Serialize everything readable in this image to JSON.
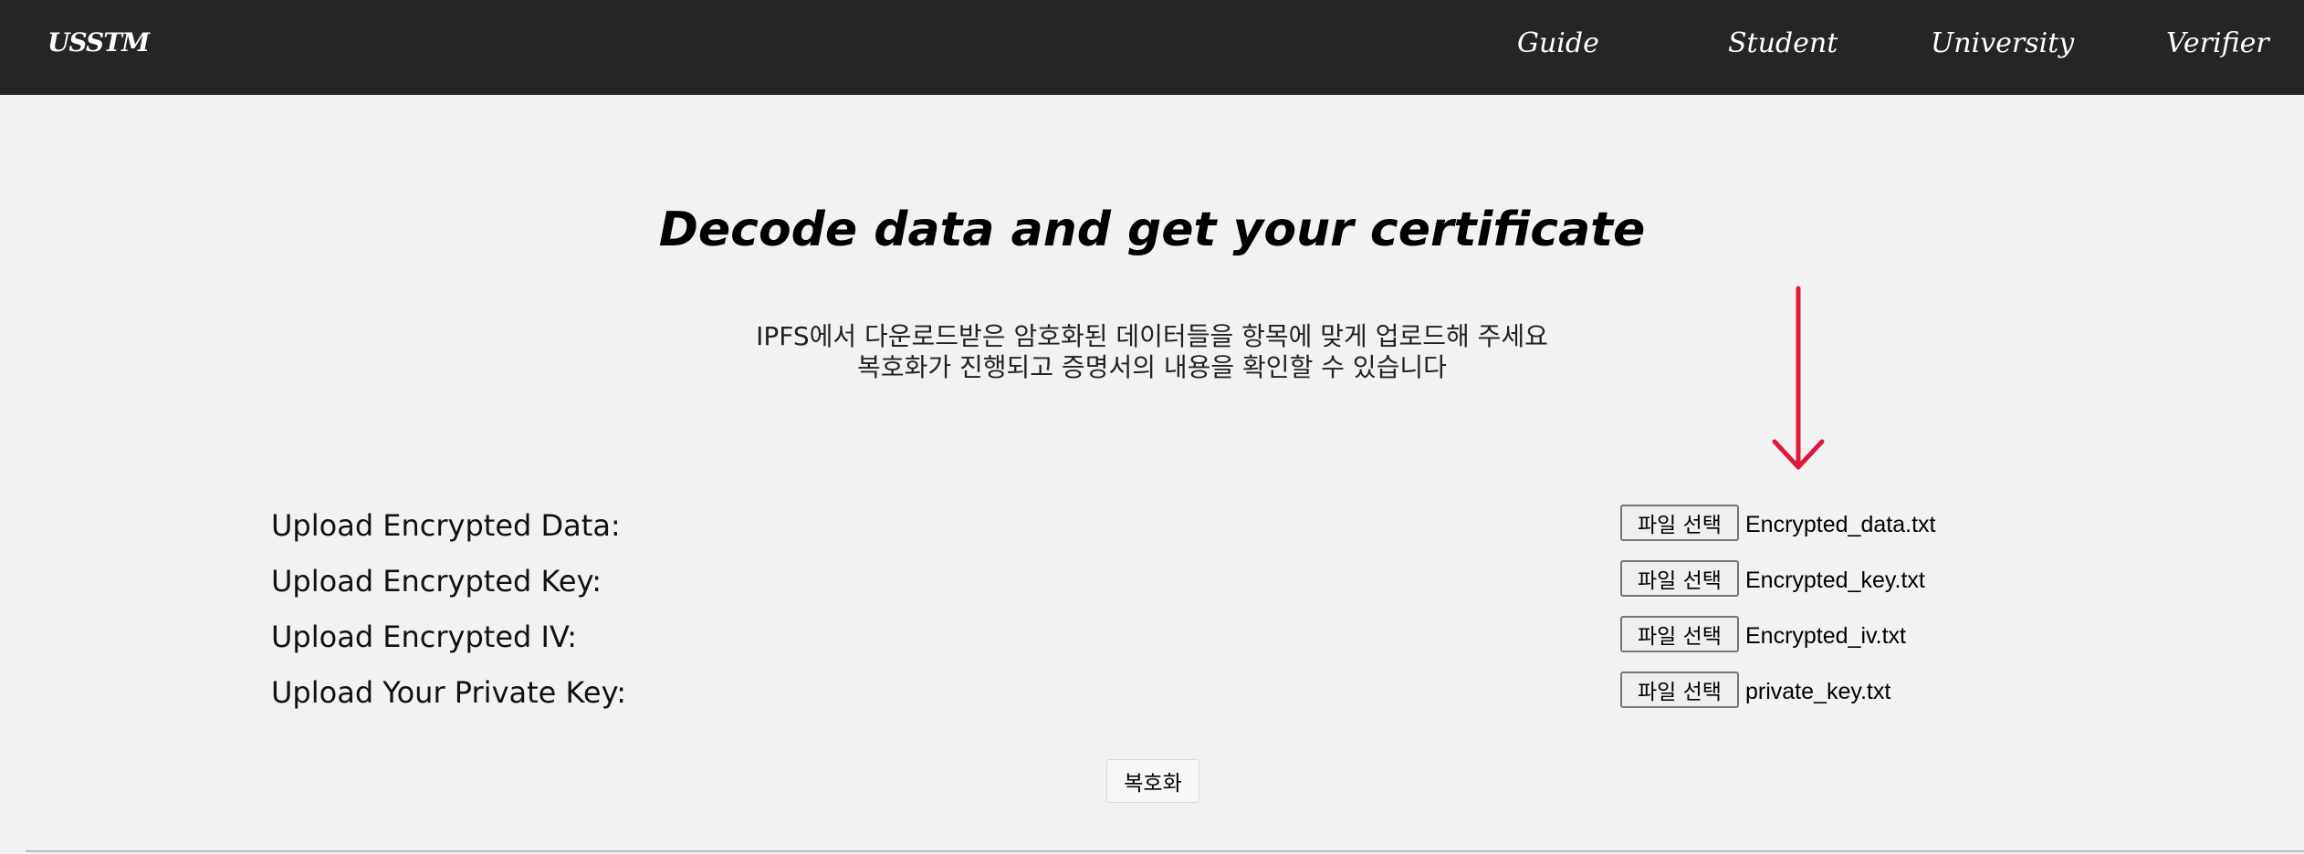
{
  "nav": {
    "brand": "USSTM",
    "links": [
      "Guide",
      "Student",
      "University",
      "Verifier"
    ]
  },
  "main": {
    "title": "Decode data and get your certificate",
    "subtitle_line1": "IPFS에서 다운로드받은 암호화된 데이터들을 항목에 맞게 업로드해 주세요",
    "subtitle_line2": "복호화가 진행되고 증명서의 내용을 확인할 수 있습니다"
  },
  "uploads": [
    {
      "label": "Upload Encrypted Data:",
      "button": "파일 선택",
      "file": "Encrypted_data.txt"
    },
    {
      "label": "Upload Encrypted Key:",
      "button": "파일 선택",
      "file": "Encrypted_key.txt"
    },
    {
      "label": "Upload Encrypted IV:",
      "button": "파일 선택",
      "file": "Encrypted_iv.txt"
    },
    {
      "label": "Upload Your Private Key:",
      "button": "파일 선택",
      "file": "private_key.txt"
    }
  ],
  "decrypt_button": "복호화",
  "colors": {
    "navbar": "#252525",
    "background": "#f2f2f2",
    "arrow": "#e0193c"
  },
  "icons": {
    "annotation": "arrow-down-icon"
  }
}
